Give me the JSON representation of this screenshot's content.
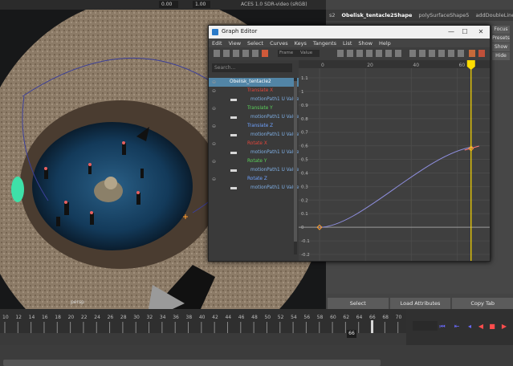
{
  "viewport": {
    "top_fields": [
      "0.00",
      "1.00"
    ],
    "color_space": "ACES 1.0 SDR-video (sRGB)",
    "camera_label": "persp"
  },
  "attribute_editor": {
    "tabs": [
      "s2",
      "Obelisk_tentacle2Shape",
      "polySurfaceShape5",
      "addDoubleLinear1"
    ],
    "active_tab": 1,
    "side_buttons": [
      "Focus",
      "Presets",
      "Show",
      "Hide"
    ],
    "bottom_buttons": [
      "Select",
      "Load Attributes",
      "Copy Tab"
    ]
  },
  "graph_editor": {
    "title": "Graph Editor",
    "window_controls": {
      "minimize": "—",
      "maximize": "☐",
      "close": "✕"
    },
    "menu": [
      "Edit",
      "View",
      "Select",
      "Curves",
      "Keys",
      "Tangents",
      "List",
      "Show",
      "Help"
    ],
    "toolbar_fields": [
      "Frame",
      "Value"
    ],
    "search_placeholder": "Search...",
    "outliner": [
      {
        "label": "Obelisk_tentacle2",
        "kind": "object",
        "color": "#ffffff",
        "selected": true
      },
      {
        "label": "Translate X",
        "kind": "attr",
        "color": "#e0463c"
      },
      {
        "label": "motionPath1 U Value",
        "kind": "curve",
        "color": "#7fb0e6"
      },
      {
        "label": "Translate Y",
        "kind": "attr",
        "color": "#5bd15b"
      },
      {
        "label": "motionPath1 U Value",
        "kind": "curve",
        "color": "#7fb0e6"
      },
      {
        "label": "Translate Z",
        "kind": "attr",
        "color": "#6ea2ff"
      },
      {
        "label": "motionPath1 U Value",
        "kind": "curve",
        "color": "#7fb0e6"
      },
      {
        "label": "Rotate X",
        "kind": "attr",
        "color": "#e0463c"
      },
      {
        "label": "motionPath1 U Value",
        "kind": "curve",
        "color": "#7fb0e6"
      },
      {
        "label": "Rotate Y",
        "kind": "attr",
        "color": "#5bd15b"
      },
      {
        "label": "motionPath1 U Value",
        "kind": "curve",
        "color": "#7fb0e6"
      },
      {
        "label": "Rotate Z",
        "kind": "attr",
        "color": "#6ea2ff"
      },
      {
        "label": "motionPath1 U Value",
        "kind": "curve",
        "color": "#7fb0e6"
      }
    ],
    "graph": {
      "x_ticks": [
        "0",
        "20",
        "40",
        "60"
      ],
      "y_ticks": [
        "1.1",
        "1",
        "0.9",
        "0.8",
        "0.7",
        "0.6",
        "0.5",
        "0.4",
        "0.3",
        "0.2",
        "0.1",
        "0",
        "-0.1",
        "-0.2"
      ],
      "current_frame_marker": "66"
    }
  },
  "timeslider": {
    "ticks": [
      "10",
      "12",
      "14",
      "16",
      "18",
      "20",
      "22",
      "24",
      "26",
      "28",
      "30",
      "32",
      "34",
      "36",
      "38",
      "40",
      "42",
      "44",
      "46",
      "48",
      "50",
      "52",
      "54",
      "56",
      "58",
      "60",
      "62",
      "64",
      "66",
      "68",
      "70"
    ],
    "current_frame": "66"
  },
  "colors": {
    "curve": "#8f8fe0",
    "current_time": "#ffdc00",
    "key": "#ff9d2e",
    "selected_row": "#5285a6"
  }
}
